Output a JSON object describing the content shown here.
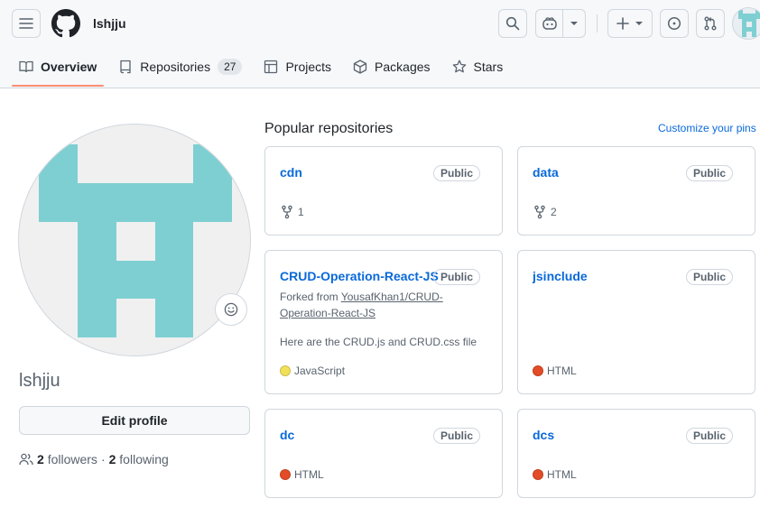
{
  "header": {
    "username": "lshjju",
    "colors": {
      "background": "#f6f8fa",
      "accent": "#0969da",
      "tab_underline": "#fd8c73"
    },
    "icons": [
      "hamburger-icon",
      "github-logo-icon",
      "search-icon",
      "copilot-icon",
      "chevron-down-icon",
      "plus-icon",
      "issue-icon",
      "pull-request-icon"
    ]
  },
  "tabs": [
    {
      "label": "Overview",
      "icon": "book-icon",
      "active": true
    },
    {
      "label": "Repositories",
      "icon": "repo-icon",
      "count": "27"
    },
    {
      "label": "Projects",
      "icon": "table-icon"
    },
    {
      "label": "Packages",
      "icon": "package-icon"
    },
    {
      "label": "Stars",
      "icon": "star-icon"
    }
  ],
  "profile": {
    "name": "lshjju",
    "edit_label": "Edit profile",
    "followers_count": "2",
    "followers_label": "followers",
    "separator": "·",
    "following_count": "2",
    "following_label": "following",
    "avatar_color": "#7ecfd2"
  },
  "popular": {
    "title": "Popular repositories",
    "customize_label": "Customize your pins",
    "repos": [
      {
        "name": "cdn",
        "visibility": "Public",
        "forks": "1"
      },
      {
        "name": "data",
        "visibility": "Public",
        "forks": "2"
      },
      {
        "name": "CRUD-Operation-React-JS",
        "visibility": "Public",
        "forked_prefix": "Forked from ",
        "forked_link_line1": "YousafKhan1/CRUD-",
        "forked_link_line2": "Operation-React-JS",
        "description": "Here are the CRUD.js and CRUD.css file",
        "language": "JavaScript",
        "language_color": "#f1e05a"
      },
      {
        "name": "jsinclude",
        "visibility": "Public",
        "language": "HTML",
        "language_color": "#e34c26"
      },
      {
        "name": "dc",
        "visibility": "Public",
        "language": "HTML",
        "language_color": "#e34c26"
      },
      {
        "name": "dcs",
        "visibility": "Public",
        "language": "HTML",
        "language_color": "#e34c26"
      }
    ]
  }
}
